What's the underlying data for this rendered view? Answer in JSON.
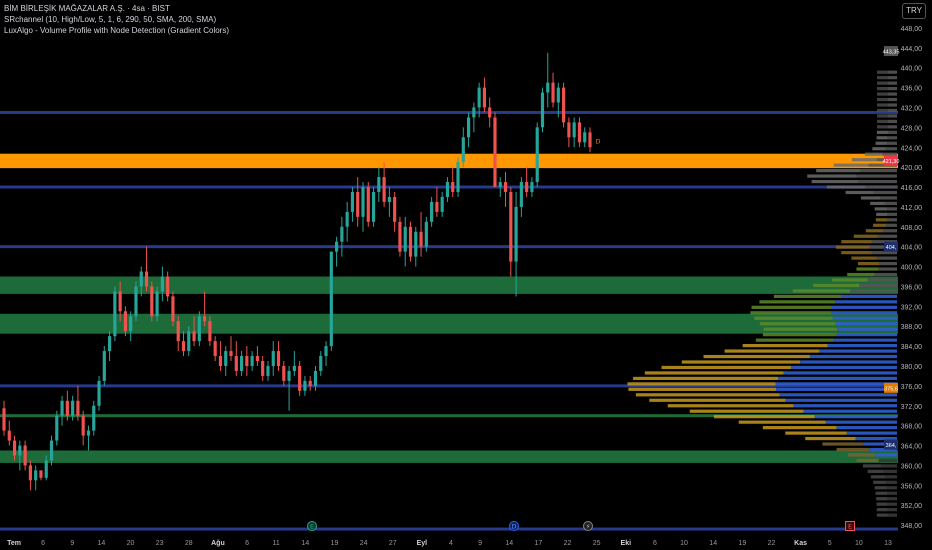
{
  "legend": {
    "title": "BİM BİRLEŞİK MAĞAZALAR A.Ş. · 4sa · BIST",
    "indicator1": "SRchannel (10, High/Low, 5, 1, 6, 290, 50, SMA, 200, SMA)",
    "indicator2": "LuxAlgo - Volume Profile with Node Detection (Gradient Colors)"
  },
  "currency": "TRY",
  "price_axis": {
    "labels": [
      "448,00",
      "444,00",
      "440,00",
      "436,00",
      "432,00",
      "428,00",
      "424,00",
      "420,00",
      "416,00",
      "412,00",
      "408,00",
      "404,00",
      "400,00",
      "396,00",
      "392,00",
      "388,00",
      "384,00",
      "380,00",
      "376,00",
      "372,00",
      "368,00",
      "364,00",
      "360,00",
      "356,00",
      "352,00",
      "348,00"
    ],
    "ticks": [
      448,
      444,
      440,
      436,
      432,
      428,
      424,
      420,
      416,
      412,
      408,
      404,
      400,
      396,
      392,
      388,
      384,
      380,
      376,
      372,
      368,
      364,
      360,
      356,
      352,
      348
    ],
    "value_tags": [
      {
        "price": 443.35,
        "text": "443,35",
        "color": "#555555"
      },
      {
        "price": 421.3,
        "text": "421,30",
        "color": "#f23645"
      },
      {
        "price": 404.0,
        "text": "404,",
        "color": "#1e2f6e"
      },
      {
        "price": 375.6,
        "text": "375,6",
        "color": "#e07b00"
      },
      {
        "price": 364.2,
        "text": "364,",
        "color": "#1e2f6e"
      }
    ]
  },
  "time_axis": {
    "labels": [
      "Tem",
      "6",
      "9",
      "14",
      "20",
      "23",
      "28",
      "Ağu",
      "6",
      "11",
      "14",
      "19",
      "24",
      "27",
      "Eyl",
      "4",
      "9",
      "14",
      "17",
      "22",
      "25",
      "Eki",
      "6",
      "10",
      "14",
      "19",
      "22",
      "Kas",
      "5",
      "10",
      "13"
    ],
    "bold": [
      "Tem",
      "Ağu",
      "Eyl",
      "Eki",
      "Kas"
    ]
  },
  "markers": [
    {
      "label": "E",
      "style": "green"
    },
    {
      "label": "D",
      "style": "blue"
    },
    {
      "label": "⚡",
      "style": "gray"
    },
    {
      "label": "E",
      "style": "red"
    },
    {
      "label": "D",
      "style": "orange"
    }
  ],
  "colors": {
    "up": "#26a69a",
    "down": "#ef5350",
    "sr_blue": "#283a8c",
    "sr_green": "#1e6b3a",
    "sr_orange": "#ff9800"
  },
  "chart_data": {
    "type": "candlestick",
    "ylim": [
      346,
      450
    ],
    "candles": [
      {
        "o": 371.5,
        "h": 373,
        "l": 366,
        "c": 367
      },
      {
        "o": 367,
        "h": 369,
        "l": 364,
        "c": 365
      },
      {
        "o": 365,
        "h": 366,
        "l": 361,
        "c": 362
      },
      {
        "o": 362,
        "h": 365,
        "l": 359,
        "c": 364
      },
      {
        "o": 364,
        "h": 365,
        "l": 359,
        "c": 360
      },
      {
        "o": 360,
        "h": 361,
        "l": 355,
        "c": 357
      },
      {
        "o": 357,
        "h": 360,
        "l": 355,
        "c": 359
      },
      {
        "o": 359,
        "h": 359,
        "l": 357,
        "c": 357.5
      },
      {
        "o": 357.5,
        "h": 362,
        "l": 357,
        "c": 361
      },
      {
        "o": 361,
        "h": 366,
        "l": 360,
        "c": 365
      },
      {
        "o": 365,
        "h": 371,
        "l": 364,
        "c": 370
      },
      {
        "o": 370,
        "h": 374,
        "l": 368,
        "c": 373
      },
      {
        "o": 373,
        "h": 375,
        "l": 369,
        "c": 370
      },
      {
        "o": 370,
        "h": 374,
        "l": 369,
        "c": 373
      },
      {
        "o": 373,
        "h": 376,
        "l": 369,
        "c": 370
      },
      {
        "o": 370,
        "h": 371,
        "l": 364,
        "c": 366
      },
      {
        "o": 366,
        "h": 368,
        "l": 363,
        "c": 367
      },
      {
        "o": 367,
        "h": 373,
        "l": 366,
        "c": 372
      },
      {
        "o": 372,
        "h": 378,
        "l": 371,
        "c": 377
      },
      {
        "o": 377,
        "h": 384,
        "l": 376,
        "c": 383
      },
      {
        "o": 383,
        "h": 387,
        "l": 381,
        "c": 386
      },
      {
        "o": 386,
        "h": 396,
        "l": 385,
        "c": 395
      },
      {
        "o": 395,
        "h": 397,
        "l": 389,
        "c": 391
      },
      {
        "o": 391,
        "h": 392,
        "l": 386,
        "c": 387
      },
      {
        "o": 387,
        "h": 391,
        "l": 385,
        "c": 390
      },
      {
        "o": 390,
        "h": 397,
        "l": 389,
        "c": 396
      },
      {
        "o": 396,
        "h": 400,
        "l": 394,
        "c": 399
      },
      {
        "o": 399,
        "h": 404,
        "l": 395,
        "c": 396
      },
      {
        "o": 396,
        "h": 397,
        "l": 389,
        "c": 390
      },
      {
        "o": 390,
        "h": 396,
        "l": 389,
        "c": 395
      },
      {
        "o": 395,
        "h": 400,
        "l": 393,
        "c": 398
      },
      {
        "o": 398,
        "h": 399,
        "l": 393,
        "c": 394
      },
      {
        "o": 394,
        "h": 395,
        "l": 388,
        "c": 389
      },
      {
        "o": 389,
        "h": 390,
        "l": 383,
        "c": 385
      },
      {
        "o": 385,
        "h": 387,
        "l": 382,
        "c": 383
      },
      {
        "o": 383,
        "h": 388,
        "l": 382,
        "c": 387
      },
      {
        "o": 387,
        "h": 390,
        "l": 384,
        "c": 385
      },
      {
        "o": 385,
        "h": 391,
        "l": 384,
        "c": 390
      },
      {
        "o": 390,
        "h": 395,
        "l": 388,
        "c": 389
      },
      {
        "o": 389,
        "h": 390,
        "l": 384,
        "c": 385
      },
      {
        "o": 385,
        "h": 386,
        "l": 381,
        "c": 382
      },
      {
        "o": 382,
        "h": 385,
        "l": 379,
        "c": 380
      },
      {
        "o": 380,
        "h": 384,
        "l": 378,
        "c": 383
      },
      {
        "o": 383,
        "h": 386,
        "l": 381,
        "c": 382
      },
      {
        "o": 382,
        "h": 385,
        "l": 378,
        "c": 379
      },
      {
        "o": 379,
        "h": 383,
        "l": 378,
        "c": 382
      },
      {
        "o": 382,
        "h": 384,
        "l": 378,
        "c": 380
      },
      {
        "o": 380,
        "h": 383,
        "l": 379,
        "c": 382
      },
      {
        "o": 382,
        "h": 384,
        "l": 380,
        "c": 381
      },
      {
        "o": 381,
        "h": 382,
        "l": 377,
        "c": 378
      },
      {
        "o": 378,
        "h": 381,
        "l": 377,
        "c": 380
      },
      {
        "o": 380,
        "h": 385,
        "l": 378,
        "c": 383
      },
      {
        "o": 383,
        "h": 385,
        "l": 379,
        "c": 380
      },
      {
        "o": 380,
        "h": 381,
        "l": 376,
        "c": 377
      },
      {
        "o": 377,
        "h": 380,
        "l": 371,
        "c": 379
      },
      {
        "o": 379,
        "h": 383,
        "l": 378,
        "c": 380
      },
      {
        "o": 380,
        "h": 381,
        "l": 374,
        "c": 375
      },
      {
        "o": 375,
        "h": 378,
        "l": 374,
        "c": 377
      },
      {
        "o": 377,
        "h": 378,
        "l": 375,
        "c": 376
      },
      {
        "o": 376,
        "h": 380,
        "l": 375,
        "c": 379
      },
      {
        "o": 379,
        "h": 383,
        "l": 378,
        "c": 382
      },
      {
        "o": 382,
        "h": 385,
        "l": 380,
        "c": 384
      },
      {
        "o": 384,
        "h": 395,
        "l": 383,
        "c": 403
      },
      {
        "o": 403,
        "h": 406,
        "l": 400,
        "c": 405
      },
      {
        "o": 405,
        "h": 410,
        "l": 402,
        "c": 408
      },
      {
        "o": 408,
        "h": 413,
        "l": 405,
        "c": 411
      },
      {
        "o": 411,
        "h": 416,
        "l": 409,
        "c": 415
      },
      {
        "o": 415,
        "h": 418,
        "l": 408,
        "c": 410
      },
      {
        "o": 410,
        "h": 417,
        "l": 407,
        "c": 416
      },
      {
        "o": 416,
        "h": 417,
        "l": 408,
        "c": 409
      },
      {
        "o": 409,
        "h": 416,
        "l": 408,
        "c": 415
      },
      {
        "o": 415,
        "h": 420,
        "l": 413,
        "c": 418
      },
      {
        "o": 418,
        "h": 421,
        "l": 412,
        "c": 413
      },
      {
        "o": 413,
        "h": 416,
        "l": 410,
        "c": 414
      },
      {
        "o": 414,
        "h": 415,
        "l": 407,
        "c": 409
      },
      {
        "o": 409,
        "h": 410,
        "l": 402,
        "c": 403
      },
      {
        "o": 403,
        "h": 410,
        "l": 400,
        "c": 408
      },
      {
        "o": 408,
        "h": 409,
        "l": 401,
        "c": 402
      },
      {
        "o": 402,
        "h": 408,
        "l": 400,
        "c": 407
      },
      {
        "o": 407,
        "h": 411,
        "l": 402,
        "c": 404
      },
      {
        "o": 404,
        "h": 410,
        "l": 403,
        "c": 409
      },
      {
        "o": 409,
        "h": 414,
        "l": 408,
        "c": 413
      },
      {
        "o": 413,
        "h": 416,
        "l": 410,
        "c": 411
      },
      {
        "o": 411,
        "h": 415,
        "l": 410,
        "c": 414
      },
      {
        "o": 414,
        "h": 418,
        "l": 413,
        "c": 417
      },
      {
        "o": 417,
        "h": 420,
        "l": 414,
        "c": 415
      },
      {
        "o": 415,
        "h": 422,
        "l": 414,
        "c": 421
      },
      {
        "o": 421,
        "h": 428,
        "l": 420,
        "c": 426
      },
      {
        "o": 426,
        "h": 431,
        "l": 424,
        "c": 430
      },
      {
        "o": 430,
        "h": 433,
        "l": 427,
        "c": 432
      },
      {
        "o": 432,
        "h": 437,
        "l": 430,
        "c": 436
      },
      {
        "o": 436,
        "h": 438,
        "l": 431,
        "c": 432
      },
      {
        "o": 432,
        "h": 434,
        "l": 428,
        "c": 430
      },
      {
        "o": 430,
        "h": 431,
        "l": 420,
        "c": 416
      },
      {
        "o": 416,
        "h": 418,
        "l": 414,
        "c": 417
      },
      {
        "o": 417,
        "h": 419,
        "l": 412,
        "c": 415
      },
      {
        "o": 415,
        "h": 416,
        "l": 398,
        "c": 401
      },
      {
        "o": 401,
        "h": 415,
        "l": 394,
        "c": 412
      },
      {
        "o": 412,
        "h": 418,
        "l": 410,
        "c": 417
      },
      {
        "o": 417,
        "h": 420,
        "l": 414,
        "c": 415
      },
      {
        "o": 415,
        "h": 418,
        "l": 414,
        "c": 417
      },
      {
        "o": 417,
        "h": 429,
        "l": 416,
        "c": 428
      },
      {
        "o": 428,
        "h": 436,
        "l": 427,
        "c": 435
      },
      {
        "o": 435,
        "h": 443,
        "l": 432,
        "c": 437
      },
      {
        "o": 437,
        "h": 439,
        "l": 432,
        "c": 433
      },
      {
        "o": 433,
        "h": 437,
        "l": 430,
        "c": 436
      },
      {
        "o": 436,
        "h": 437,
        "l": 428,
        "c": 429
      },
      {
        "o": 429,
        "h": 430,
        "l": 424,
        "c": 426
      },
      {
        "o": 426,
        "h": 430,
        "l": 424,
        "c": 429
      },
      {
        "o": 429,
        "h": 430,
        "l": 424,
        "c": 425
      },
      {
        "o": 425,
        "h": 428,
        "l": 424,
        "c": 427
      },
      {
        "o": 427,
        "h": 428,
        "l": 423,
        "c": 424
      }
    ],
    "sr_zones": [
      {
        "top": 431.3,
        "bottom": 430.7,
        "color": "sr_blue"
      },
      {
        "top": 422.7,
        "bottom": 419.8,
        "color": "sr_orange"
      },
      {
        "top": 416.3,
        "bottom": 415.7,
        "color": "sr_blue"
      },
      {
        "top": 404.3,
        "bottom": 403.7,
        "color": "sr_blue"
      },
      {
        "top": 398.0,
        "bottom": 394.5,
        "color": "sr_green"
      },
      {
        "top": 390.5,
        "bottom": 386.5,
        "color": "sr_green"
      },
      {
        "top": 376.3,
        "bottom": 375.7,
        "color": "sr_blue"
      },
      {
        "top": 370.3,
        "bottom": 369.7,
        "color": "sr_green"
      },
      {
        "top": 363.0,
        "bottom": 360.5,
        "color": "sr_green"
      },
      {
        "top": 347.5,
        "bottom": 346.9,
        "color": "sr_blue"
      }
    ]
  }
}
